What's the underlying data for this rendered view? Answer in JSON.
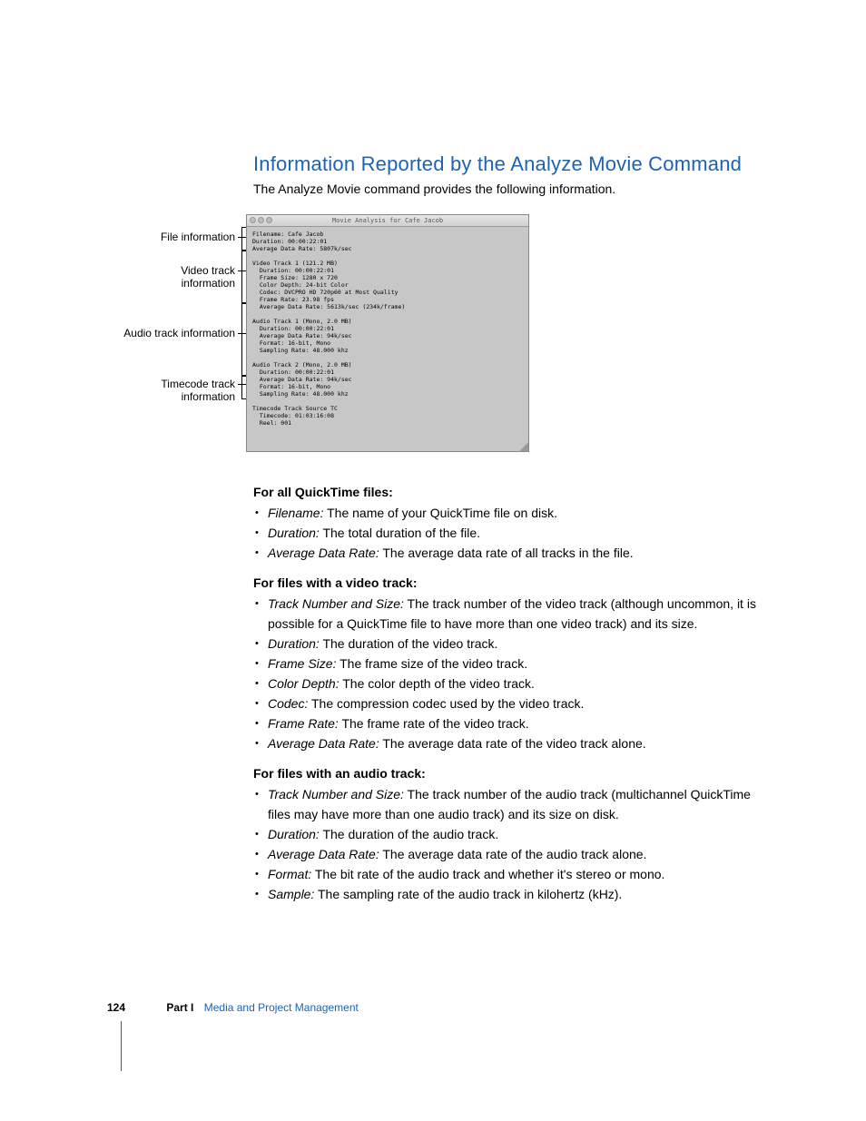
{
  "heading": "Information Reported by the Analyze Movie Command",
  "intro": "The Analyze Movie command provides the following information.",
  "callouts": {
    "file": "File information",
    "video": "Video track information",
    "audio": "Audio track information",
    "tc1": "Timecode track",
    "tc2": "information"
  },
  "window": {
    "title": "Movie Analysis for Cafe Jacob",
    "file": "Filename: Cafe Jacob\nDuration: 00:00:22:01\nAverage Data Rate: 5807k/sec",
    "video": "Video Track 1 (121.2 MB)\n  Duration: 00:00:22:01\n  Frame Size: 1280 x 720\n  Color Depth: 24-bit Color\n  Codec: DVCPRO HD 720p60 at Most Quality\n  Frame Rate: 23.98 fps\n  Average Data Rate: 5613k/sec (234k/frame)",
    "audio": "Audio Track 1 (Mono, 2.0 MB)\n  Duration: 00:00:22:01\n  Average Data Rate: 94k/sec\n  Format: 16-bit, Mono\n  Sampling Rate: 48.000 khz\n\nAudio Track 2 (Mono, 2.0 MB)\n  Duration: 00:00:22:01\n  Average Data Rate: 94k/sec\n  Format: 16-bit, Mono\n  Sampling Rate: 48.000 khz",
    "tc": "Timecode Track Source TC\n  Timecode: 01:03:16:08\n  Reel: 001"
  },
  "sections": [
    {
      "title": "For all QuickTime files:",
      "items": [
        {
          "term": "Filename:",
          "desc": "  The name of your QuickTime file on disk."
        },
        {
          "term": "Duration:",
          "desc": "  The total duration of the file."
        },
        {
          "term": "Average Data Rate:",
          "desc": "  The average data rate of all tracks in the file."
        }
      ]
    },
    {
      "title": "For files with a video track:",
      "items": [
        {
          "term": "Track Number and Size:",
          "desc": "  The track number of the video track (although uncommon, it is possible for a QuickTime file to have more than one video track) and its size."
        },
        {
          "term": "Duration:",
          "desc": "  The duration of the video track."
        },
        {
          "term": "Frame Size:",
          "desc": "  The frame size of the video track."
        },
        {
          "term": "Color Depth:",
          "desc": "  The color depth of the video track."
        },
        {
          "term": "Codec:",
          "desc": "  The compression codec used by the video track."
        },
        {
          "term": "Frame Rate:",
          "desc": "  The frame rate of the video track."
        },
        {
          "term": "Average Data Rate:",
          "desc": "  The average data rate of the video track alone."
        }
      ]
    },
    {
      "title": "For files with an audio track:",
      "items": [
        {
          "term": "Track Number and Size:",
          "desc": "  The track number of the audio track (multichannel QuickTime files may have more than one audio track) and its size on disk."
        },
        {
          "term": "Duration:",
          "desc": "  The duration of the audio track."
        },
        {
          "term": "Average Data Rate:",
          "desc": "  The average data rate of the audio track alone."
        },
        {
          "term": "Format:",
          "desc": "  The bit rate of the audio track and whether it's stereo or mono."
        },
        {
          "term": "Sample:",
          "desc": "  The sampling rate of the audio track in kilohertz (kHz)."
        }
      ]
    }
  ],
  "footer": {
    "page": "124",
    "part": "Part I",
    "section": "Media and Project Management"
  }
}
